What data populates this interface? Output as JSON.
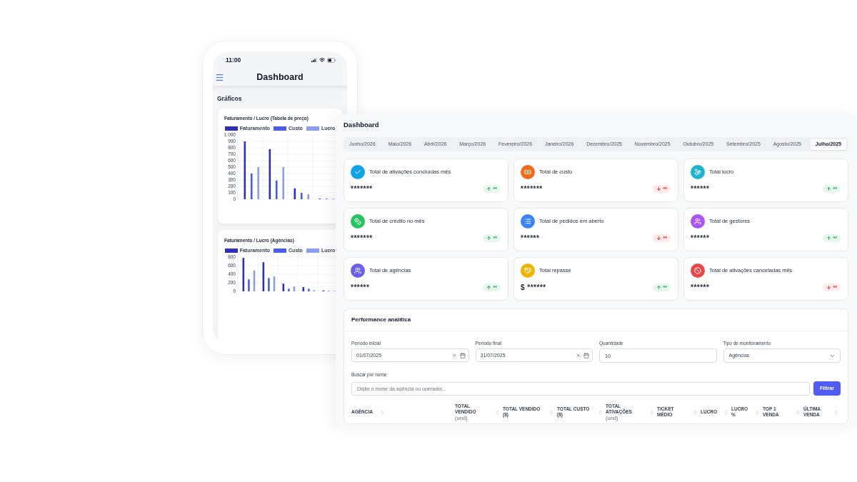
{
  "phone": {
    "status_bar": {
      "time": "11:00"
    },
    "header": {
      "title": "Dashboard"
    },
    "section_title": "Gráficos",
    "charts": [
      {
        "chart_data": {
          "type": "bar",
          "title": "Faturamento / Lucro (Tabela de preço)",
          "legend": "top",
          "grid": true,
          "series": [
            {
              "name": "Faturamento",
              "color": "#2e2fbf",
              "values": [
                900,
                780,
                170,
                10
              ]
            },
            {
              "name": "Custo",
              "color": "#4a5cf0",
              "values": [
                400,
                290,
                100,
                10
              ]
            },
            {
              "name": "Lucro",
              "color": "#8b9cf6",
              "values": [
                500,
                500,
                80,
                10
              ]
            }
          ],
          "ylim": [
            0,
            1000
          ],
          "yticks": [
            0,
            100,
            200,
            300,
            400,
            500,
            600,
            700,
            800,
            900,
            {
              "value": 1000,
              "label": "1.000"
            }
          ]
        }
      },
      {
        "chart_data": {
          "type": "bar",
          "title": "Faturamento / Lucro (Agências)",
          "legend": "top",
          "grid": true,
          "series": [
            {
              "name": "Faturamento",
              "color": "#2e2fbf",
              "values": [
                780,
                680,
                180,
                100,
                20
              ]
            },
            {
              "name": "Custo",
              "color": "#4a5cf0",
              "values": [
                280,
                310,
                60,
                60,
                10
              ]
            },
            {
              "name": "Lucro",
              "color": "#8b9cf6",
              "values": [
                490,
                350,
                110,
                30,
                10
              ]
            }
          ],
          "ylim": [
            0,
            800
          ],
          "yticks": [
            0,
            200,
            400,
            600,
            800
          ]
        }
      }
    ]
  },
  "dashboard": {
    "title": "Dashboard",
    "tabs": [
      {
        "label": "Junho/2026",
        "selected": false
      },
      {
        "label": "Maio/2026",
        "selected": false
      },
      {
        "label": "Abril/2026",
        "selected": false
      },
      {
        "label": "Março/2026",
        "selected": false
      },
      {
        "label": "Fevereiro/2026",
        "selected": false
      },
      {
        "label": "Janeiro/2026",
        "selected": false
      },
      {
        "label": "Dezembro/2025",
        "selected": false
      },
      {
        "label": "Novembro/2025",
        "selected": false
      },
      {
        "label": "Outubro/2025",
        "selected": false
      },
      {
        "label": "Setembro/2025",
        "selected": false
      },
      {
        "label": "Agosto/2025",
        "selected": false
      },
      {
        "label": "Julho/2025",
        "selected": true
      }
    ],
    "cards": [
      {
        "title": "Total de ativações concluídas mês",
        "value": "*******",
        "color": "#0ea5e9",
        "rising": true,
        "change": "**"
      },
      {
        "title": "Total de custo",
        "value": "*******",
        "color": "#f26b1d",
        "rising": false,
        "change": "**"
      },
      {
        "title": "Total lucro",
        "value": "******",
        "color": "#1bb3cf",
        "rising": true,
        "change": "**"
      },
      {
        "title": "Total de crédito no mês",
        "value": "*******",
        "color": "#22c55e",
        "rising": true,
        "change": "**"
      },
      {
        "title": "Total de pedidos em aberto",
        "value": "******",
        "color": "#3b82f6",
        "rising": false,
        "change": "**"
      },
      {
        "title": "Total de gestores",
        "value": "******",
        "color": "#a855f7",
        "rising": true,
        "change": "**"
      },
      {
        "title": "Total de agências",
        "value": "******",
        "color": "#6a5ef0",
        "rising": true,
        "change": "**"
      },
      {
        "title": "Total repasse",
        "value": "$ ******",
        "color": "#f0b400",
        "rising": true,
        "change": "**"
      },
      {
        "title": "Total de ativações canceladas mês",
        "value": "******",
        "color": "#ef4444",
        "rising": false,
        "change": "**"
      }
    ],
    "performance": {
      "title": "Performance analítica",
      "filters": [
        {
          "kind": "date",
          "label": "Período inicial",
          "value": "01/07/2025"
        },
        {
          "kind": "date",
          "label": "Período final",
          "value": "31/07/2025"
        },
        {
          "kind": "number",
          "label": "Quantidade",
          "value": "10"
        },
        {
          "kind": "select",
          "label": "Tipo de monitoramento",
          "value": "Agências"
        }
      ],
      "search": {
        "label": "Buscar por nome",
        "placeholder": "Digite o nome da agência ou operador...",
        "button": "Filtrar"
      },
      "table": {
        "columns": [
          {
            "label": "AGÊNCIA"
          },
          {
            "label": "TOTAL VENDIDO",
            "unit": "(und)"
          },
          {
            "label": "TOTAL VENDIDO ($)"
          },
          {
            "label": "TOTAL CUSTO ($)"
          },
          {
            "label": "TOTAL ATIVAÇÕES",
            "unit": "(und)"
          },
          {
            "label": "TICKET MÉDIO"
          },
          {
            "label": "LUCRO"
          },
          {
            "label": "LUCRO %"
          },
          {
            "label": "TOP 1 VENDA"
          },
          {
            "label": "ÚLTIMA VENDA"
          }
        ]
      }
    }
  }
}
